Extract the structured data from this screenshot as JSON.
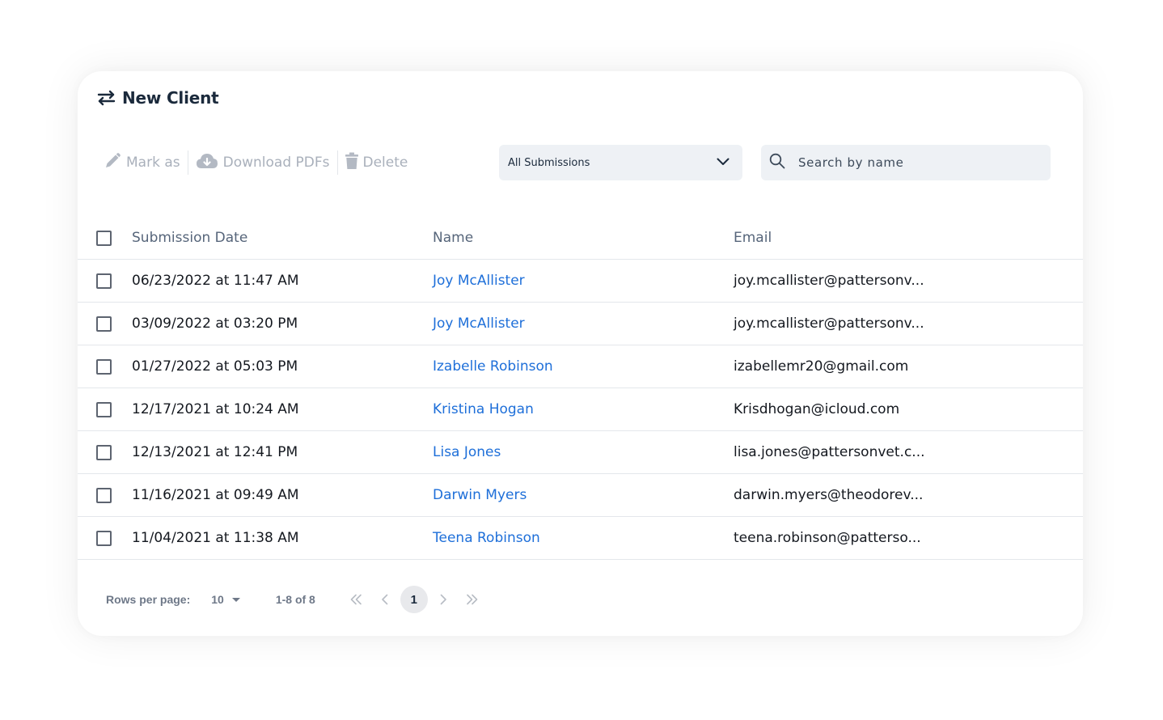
{
  "header": {
    "title": "New Client"
  },
  "toolbar": {
    "mark_as_label": "Mark as",
    "download_label": "Download PDFs",
    "delete_label": "Delete"
  },
  "filter": {
    "selected": "All Submissions"
  },
  "search": {
    "placeholder": "Search by name",
    "value": ""
  },
  "table": {
    "columns": [
      "Submission Date",
      "Name",
      "Email"
    ],
    "rows": [
      {
        "date": "06/23/2022 at 11:47 AM",
        "name": "Joy McAllister",
        "email": "joy.mcallister@pattersonv..."
      },
      {
        "date": "03/09/2022 at 03:20 PM",
        "name": "Joy McAllister",
        "email": "joy.mcallister@pattersonv..."
      },
      {
        "date": "01/27/2022 at 05:03 PM",
        "name": "Izabelle Robinson",
        "email": "izabellemr20@gmail.com"
      },
      {
        "date": "12/17/2021 at 10:24 AM",
        "name": "Kristina Hogan",
        "email": "Krisdhogan@icloud.com"
      },
      {
        "date": "12/13/2021 at 12:41 PM",
        "name": "Lisa Jones",
        "email": "lisa.jones@pattersonvet.c..."
      },
      {
        "date": "11/16/2021 at 09:49 AM",
        "name": "Darwin Myers",
        "email": "darwin.myers@theodorev..."
      },
      {
        "date": "11/04/2021 at 11:38 AM",
        "name": "Teena Robinson",
        "email": "teena.robinson@patterso..."
      }
    ]
  },
  "pagination": {
    "rows_per_page_label": "Rows per page:",
    "rows_per_page": "10",
    "range": "1-8 of 8",
    "current_page": "1"
  },
  "colors": {
    "link": "#1e6fd9",
    "text": "#14181f",
    "muted": "#a9b0bb",
    "field_bg": "#eef1f5"
  }
}
